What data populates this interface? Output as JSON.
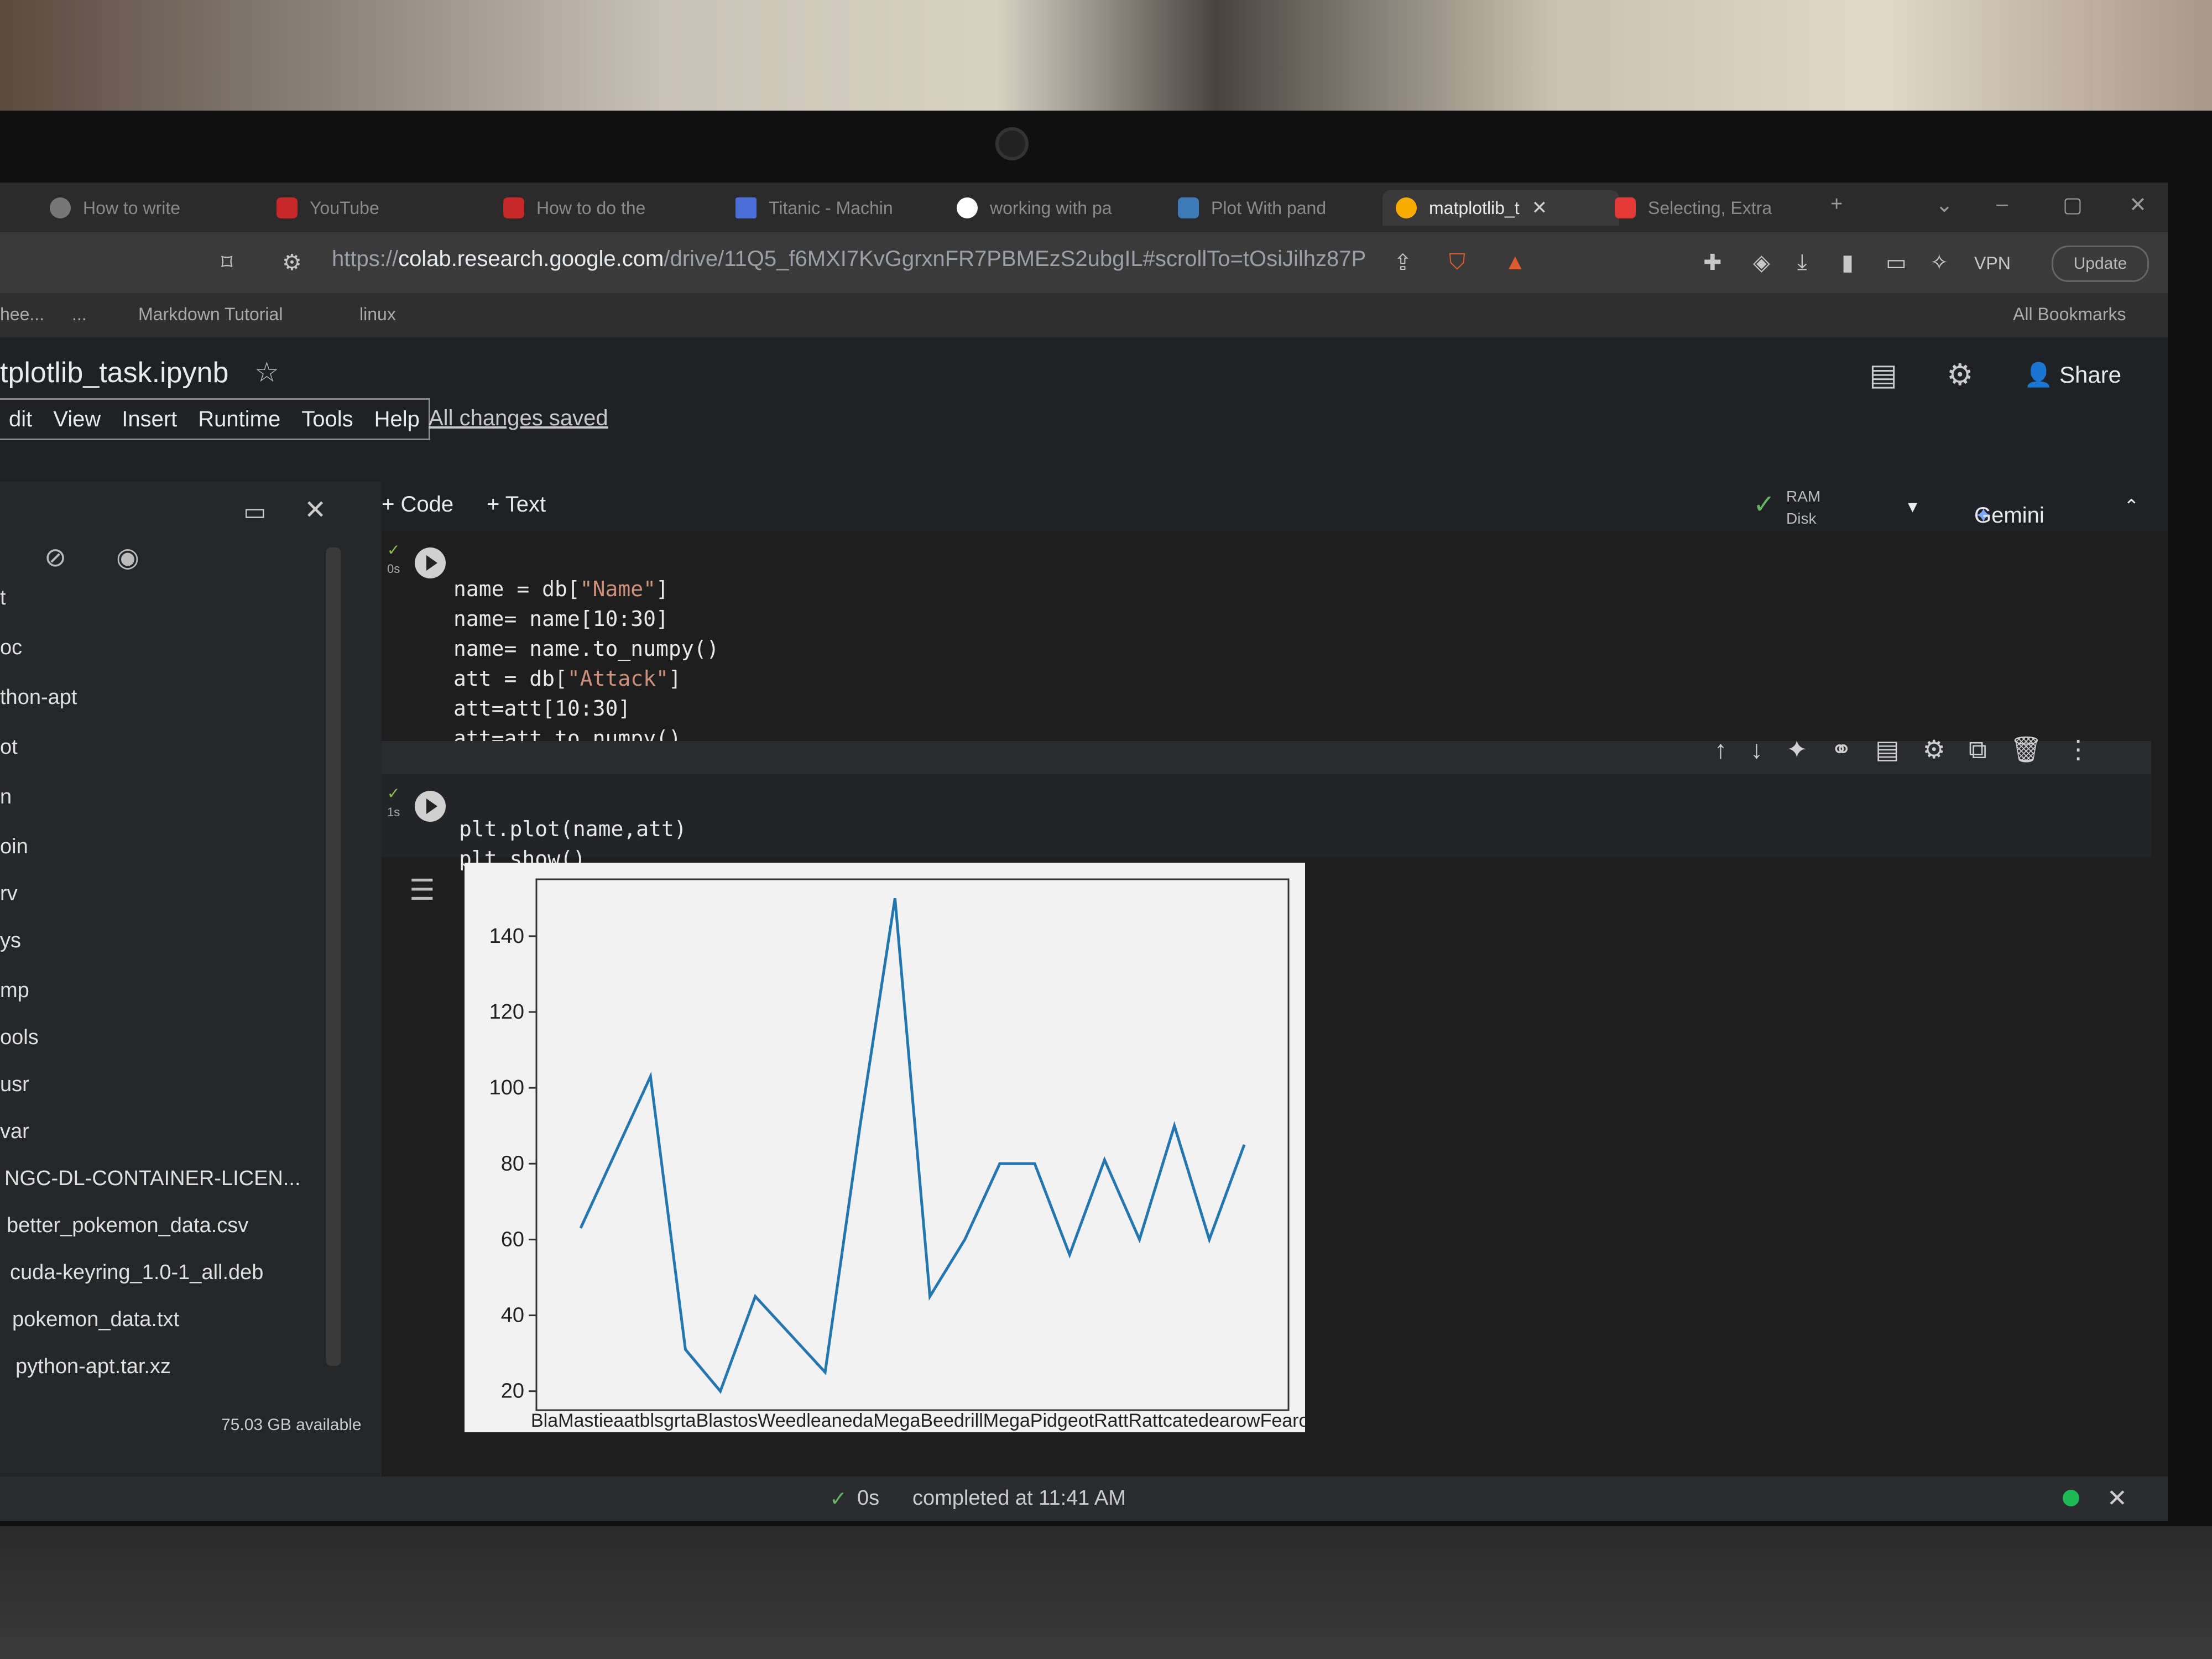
{
  "browser": {
    "tabs": [
      {
        "label": "How to write",
        "icon": "audio-icon",
        "active": false
      },
      {
        "label": "YouTube",
        "icon": "youtube-icon",
        "active": false
      },
      {
        "label": "How to do the",
        "icon": "youtube-icon",
        "active": false
      },
      {
        "label": "Titanic - Machin",
        "icon": "kaggle-icon",
        "active": false
      },
      {
        "label": "working with pa",
        "icon": "google-icon",
        "active": false
      },
      {
        "label": "Plot With pand",
        "icon": "python-icon",
        "active": false
      },
      {
        "label": "matplotlib_t",
        "icon": "colab-icon",
        "active": true
      },
      {
        "label": "Selecting, Extra",
        "icon": "brave-icon",
        "active": false
      }
    ],
    "url_prefix": "https://",
    "url_domain": "colab.research.google.com",
    "url_path": "/drive/11Q5_f6MXI7KvGgrxnFR7PBMEzS2ubgIL#scrollTo=tOsiJilhz87P",
    "vpn_label": "VPN",
    "update_label": "Update",
    "bookmarks": [
      "hee...",
      "...",
      "Markdown Tutorial",
      "linux"
    ],
    "all_bookmarks": "All Bookmarks"
  },
  "colab": {
    "filename": "tplotlib_task.ipynb",
    "menu": [
      "dit",
      "View",
      "Insert",
      "Runtime",
      "Tools",
      "Help"
    ],
    "saved_status": "All changes saved",
    "share_label": "Share",
    "add_code": "+ Code",
    "add_text": "+ Text",
    "ram_label": "RAM",
    "disk_label": "Disk",
    "gemini_label": "Gemini"
  },
  "sidebar": {
    "items": [
      "t",
      "oc",
      "thon-apt",
      "ot",
      "n",
      "oin",
      "rv",
      "ys",
      "mp",
      "ools",
      "usr",
      "var",
      "NGC-DL-CONTAINER-LICEN...",
      "better_pokemon_data.csv",
      "cuda-keyring_1.0-1_all.deb",
      "pokemon_data.txt",
      "python-apt.tar.xz"
    ],
    "disk_available": "75.03 GB available"
  },
  "cells": [
    {
      "exec_time": "0s",
      "lines": [
        {
          "pre": "name = db[",
          "str": "\"Name\"",
          "post": "]"
        },
        {
          "pre": "name= name[10:30]",
          "str": "",
          "post": ""
        },
        {
          "pre": "name= name.to_numpy()",
          "str": "",
          "post": ""
        },
        {
          "pre": "att = db[",
          "str": "\"Attack\"",
          "post": "]"
        },
        {
          "pre": "att=att[10:30]",
          "str": "",
          "post": ""
        },
        {
          "pre": "att=att.to_numpy()",
          "str": "",
          "post": ""
        }
      ]
    },
    {
      "exec_time": "1s",
      "lines": [
        {
          "pre": "plt.plot(name,att)",
          "str": "",
          "post": ""
        },
        {
          "pre": "plt.show()",
          "str": "",
          "post": ""
        }
      ]
    }
  ],
  "chart_data": {
    "type": "line",
    "title": "",
    "xlabel": "",
    "ylabel": "",
    "x_tick_text": "BlaMastieaatblsgrtaBlastosWeedleanedaMegaBeedrillMegaPidgeotRattRattcatedearowFearowArbok",
    "y_ticks": [
      20,
      40,
      60,
      80,
      100,
      120,
      140
    ],
    "ylim": [
      15,
      155
    ],
    "values": [
      63,
      83,
      103,
      31,
      20,
      45,
      35,
      25,
      90,
      150,
      45,
      60,
      80,
      80,
      56,
      81,
      60,
      90,
      60,
      85
    ],
    "color": "#1f77b4",
    "grid": false
  },
  "statusbar": {
    "time": "0s",
    "message": "completed at 11:41 AM"
  }
}
